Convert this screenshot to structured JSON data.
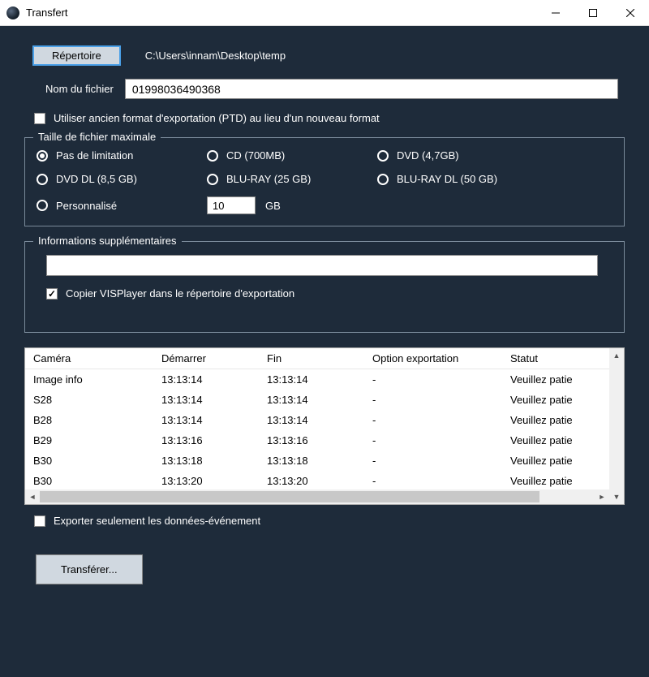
{
  "window": {
    "title": "Transfert"
  },
  "directory": {
    "button_label": "Répertoire",
    "path": "C:\\Users\\innam\\Desktop\\temp"
  },
  "filename": {
    "label": "Nom du fichier",
    "value": "01998036490368"
  },
  "old_format": {
    "checked": false,
    "label": "Utiliser ancien format d'exportation (PTD) au lieu d'un nouveau format"
  },
  "filesize": {
    "legend": "Taille de fichier maximale",
    "options": {
      "none": "Pas de limitation",
      "cd": "CD (700MB)",
      "dvd": "DVD (4,7GB)",
      "dvddl": "DVD DL (8,5 GB)",
      "bluray": "BLU-RAY (25 GB)",
      "bluraydl": "BLU-RAY DL (50 GB)",
      "custom": "Personnalisé"
    },
    "selected": "none",
    "custom_value": "10",
    "custom_unit": "GB"
  },
  "extra": {
    "legend": "Informations supplémentaires",
    "info_value": "",
    "copy_player": {
      "checked": true,
      "label": "Copier VISPlayer dans le répertoire d'exportation"
    }
  },
  "table": {
    "headers": [
      "Caméra",
      "Démarrer",
      "Fin",
      "Option exportation",
      "Statut"
    ],
    "rows": [
      {
        "c": [
          "Image info",
          "13:13:14",
          "13:13:14",
          "-",
          "Veuillez patie"
        ]
      },
      {
        "c": [
          "S28",
          "13:13:14",
          "13:13:14",
          "-",
          "Veuillez patie"
        ]
      },
      {
        "c": [
          "B28",
          "13:13:14",
          "13:13:14",
          "-",
          "Veuillez patie"
        ]
      },
      {
        "c": [
          "B29",
          "13:13:16",
          "13:13:16",
          "-",
          "Veuillez patie"
        ]
      },
      {
        "c": [
          "B30",
          "13:13:18",
          "13:13:18",
          "-",
          "Veuillez patie"
        ]
      },
      {
        "c": [
          "B30",
          "13:13:20",
          "13:13:20",
          "-",
          "Veuillez patie"
        ]
      }
    ]
  },
  "export_events": {
    "checked": false,
    "label": "Exporter seulement les données-événement"
  },
  "transfer_button": "Transférer..."
}
